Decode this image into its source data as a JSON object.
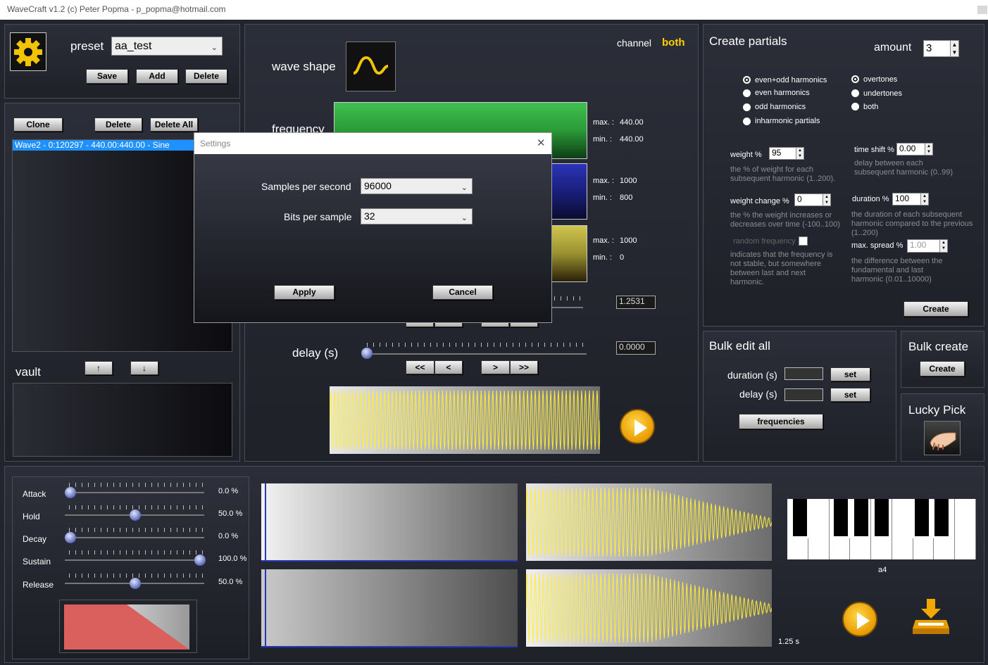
{
  "window": {
    "title": "WaveCraft v1.2   (c) Peter Popma - p_popma@hotmail.com"
  },
  "preset": {
    "label": "preset",
    "value": "aa_test",
    "save": "Save",
    "add": "Add",
    "delete": "Delete"
  },
  "wavelist": {
    "clone": "Clone",
    "delete": "Delete",
    "delete_all": "Delete All",
    "items": [
      "Wave2 - 0:120297 - 440.00:440.00 - Sine"
    ],
    "up": "↑",
    "down": "↓"
  },
  "vault": {
    "label": "vault"
  },
  "wave": {
    "channel_label": "channel",
    "channel_value": "both",
    "shape_label": "wave shape",
    "frequency_label": "frequency",
    "freq_max_label": "max. :",
    "freq_max": "440.00",
    "freq_min_label": "min. :",
    "freq_min": "440.00",
    "b_max_label": "max. :",
    "b_max": "1000",
    "b_min_label": "min. :",
    "b_min": "800",
    "c_max_label": "max. :",
    "c_max": "1000",
    "c_min_label": "min. :",
    "c_min": "0",
    "duration_value": "1.2531",
    "delay_label": "delay (s)",
    "delay_value": "0.0000",
    "nav": [
      "<<",
      "<",
      ">",
      ">>"
    ]
  },
  "partials": {
    "title": "Create partials",
    "amount_label": "amount",
    "amount": "3",
    "options_left": [
      "even+odd harmonics",
      "even harmonics",
      "odd harmonics",
      "inharmonic partials"
    ],
    "options_right": [
      "overtones",
      "undertones",
      "both"
    ],
    "weight_label": "weight %",
    "weight": "95",
    "weight_desc": "the % of weight for each subsequent harmonic (1..200).",
    "timeshift_label": "time shift %",
    "timeshift": "0.00",
    "timeshift_desc": "delay between each subsequent harmonic (0..99)",
    "weightchange_label": "weight change %",
    "weightchange": "0",
    "weightchange_desc": "the % the weight increases or decreases over time (-100..100)",
    "duration_label": "duration %",
    "duration": "100",
    "duration_desc": "the duration of each subsequent harmonic compared to the previous (1..200)",
    "random_label": "random frequency",
    "random_desc": "indicates that the frequency is not stable, but somewhere between last and next harmonic.",
    "spread_label": "max. spread %",
    "spread": "1.00",
    "spread_desc": "the difference between the fundamental and last harmonic (0.01..10000)",
    "create": "Create"
  },
  "bulk_edit": {
    "title": "Bulk edit all",
    "duration_label": "duration (s)",
    "delay_label": "delay (s)",
    "set": "set",
    "frequencies": "frequencies"
  },
  "bulk_create": {
    "title": "Bulk create",
    "create": "Create"
  },
  "lucky": {
    "title": "Lucky Pick"
  },
  "envelope": {
    "rows": [
      {
        "label": "Attack",
        "value": "0.0 %",
        "pos": 0.0
      },
      {
        "label": "Hold",
        "value": "50.0 %",
        "pos": 0.5
      },
      {
        "label": "Decay",
        "value": "0.0 %",
        "pos": 0.0
      },
      {
        "label": "Sustain",
        "value": "100.0 %",
        "pos": 1.0
      },
      {
        "label": "Release",
        "value": "50.0 %",
        "pos": 0.5
      }
    ]
  },
  "keyboard": {
    "note": "a4"
  },
  "time_label": "1.25 s",
  "settings_dialog": {
    "title": "Settings",
    "close": "✕",
    "sps_label": "Samples per second",
    "sps": "96000",
    "bps_label": "Bits per sample",
    "bps": "32",
    "apply": "Apply",
    "cancel": "Cancel"
  },
  "colors": {
    "accent": "#ffd000",
    "selection": "#1e90ff",
    "freq_green": "#3bb54a",
    "blue": "#1b1f7a",
    "yellow": "#c8be48",
    "envelope_red": "#d9605c"
  }
}
